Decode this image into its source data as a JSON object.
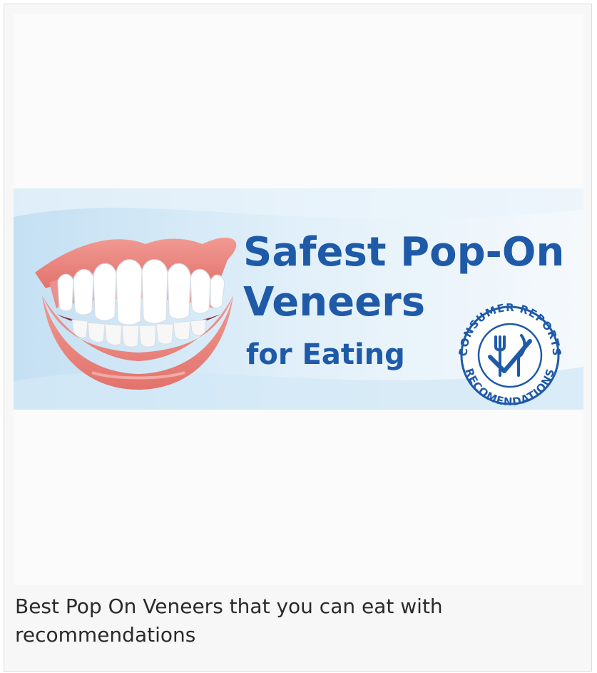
{
  "banner": {
    "title_line1": "Safest Pop-On",
    "title_line2": "Veneers",
    "title_line3": "for Eating",
    "badge_top": "CONSUMER REPORTS",
    "badge_bottom": "RECOMENDATIONS",
    "title_color": "#1f5aa8",
    "background_color": "#d6e9f6"
  },
  "caption": {
    "text": "Best Pop On Veneers that you can eat with recommendations"
  }
}
